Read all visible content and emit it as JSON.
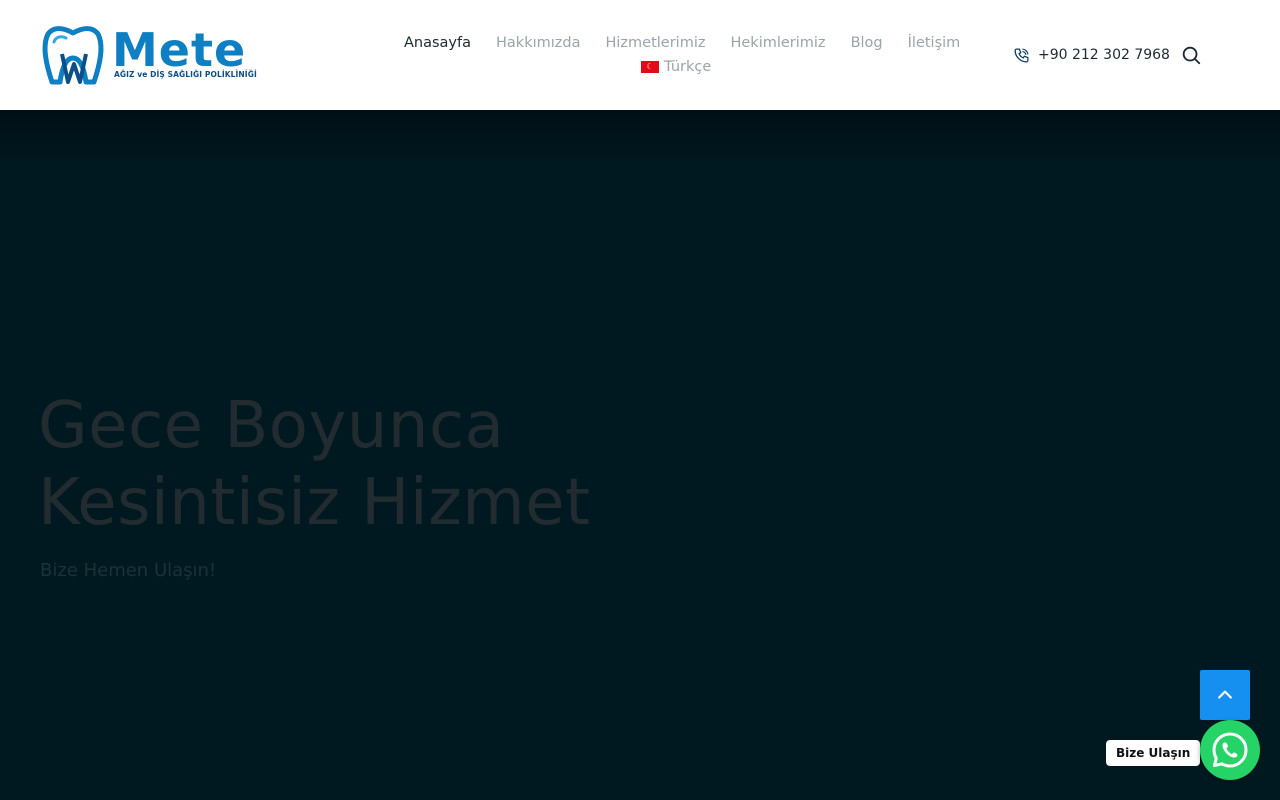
{
  "header": {
    "logo": {
      "name": "Mete",
      "subtitle": "AĞIZ ve DİŞ SAĞLIĞI POLİKLİNİĞİ"
    },
    "nav": [
      {
        "label": "Anasayfa",
        "active": true
      },
      {
        "label": "Hakkımızda",
        "active": false
      },
      {
        "label": "Hizmetlerimiz",
        "active": false
      },
      {
        "label": "Hekimlerimiz",
        "active": false
      },
      {
        "label": "Blog",
        "active": false
      },
      {
        "label": "İletişim",
        "active": false
      }
    ],
    "language": {
      "label": "Türkçe",
      "icon": "turkey-flag-icon"
    },
    "phone": {
      "number": "+90 212 302 7968",
      "icon": "phone-icon"
    },
    "search_icon": "search-icon"
  },
  "hero": {
    "title_line1": "Gece Boyunca",
    "title_line2": "Kesintisiz Hizmet",
    "subtitle": "Bize Hemen Ulaşın!"
  },
  "floating": {
    "whatsapp_label": "Bize Ulaşın",
    "whatsapp_icon": "whatsapp-icon",
    "back_to_top_icon": "chevron-up-icon"
  },
  "colors": {
    "brand_blue": "#0d7fc2",
    "hero_bg": "#001920",
    "back_to_top": "#1590f0",
    "whatsapp_green": "#25d366"
  }
}
